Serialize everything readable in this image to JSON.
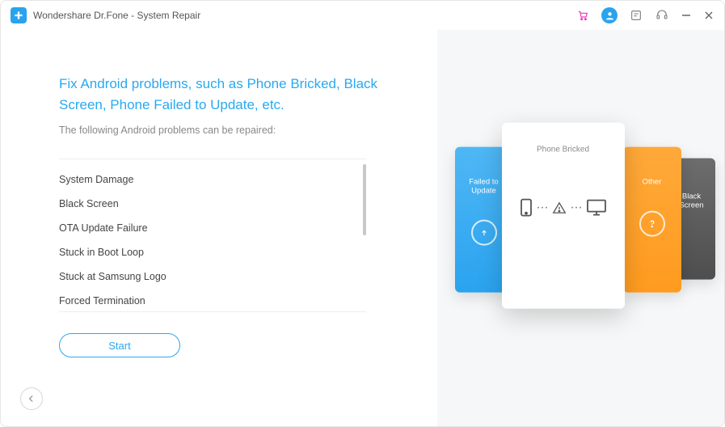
{
  "app": {
    "title": "Wondershare Dr.Fone - System Repair"
  },
  "main": {
    "headline": "Fix Android problems, such as Phone Bricked, Black Screen, Phone Failed to Update, etc.",
    "subline": "The following Android problems can be repaired:",
    "problems": [
      "System Damage",
      "Black Screen",
      "OTA Update Failure",
      "Stuck in Boot Loop",
      "Stuck at Samsung Logo",
      "Forced Termination"
    ],
    "start_label": "Start"
  },
  "cards": {
    "blue_line1": "Failed to",
    "blue_line2": "Update",
    "orange_label": "Other",
    "gray_line1": "Black",
    "gray_line2": "Screen",
    "white_label": "Phone Bricked"
  },
  "colors": {
    "accent": "#29a9f0",
    "orange": "#ff9b1f",
    "gray_card": "#5a5a5a"
  }
}
